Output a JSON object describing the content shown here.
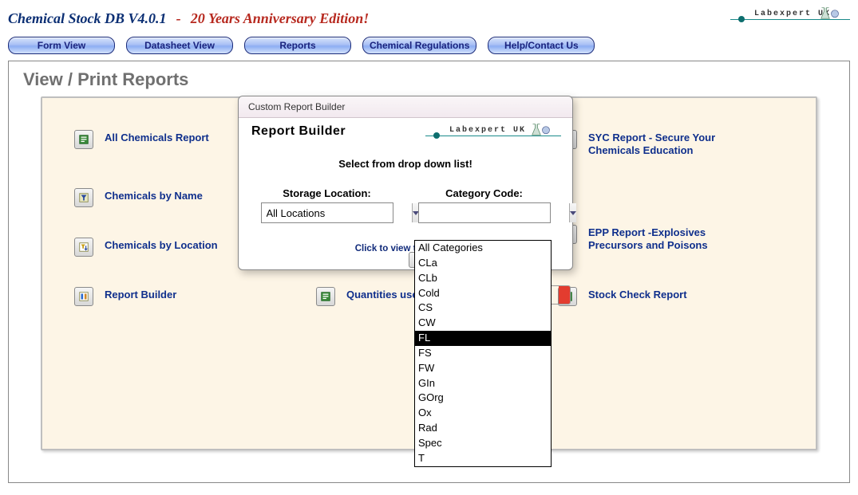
{
  "app": {
    "title": "Chemical Stock DB V4.0.1",
    "sep": "-",
    "subtitle": "20 Years Anniversary Edition!",
    "logo_text": "Labexpert UK"
  },
  "menu": {
    "form_view": "Form View",
    "datasheet_view": "Datasheet View",
    "reports": "Reports",
    "chem_reg": "Chemical Regulations",
    "help": "Help/Contact Us"
  },
  "page": {
    "heading": "View / Print Reports"
  },
  "reports": {
    "all_chem": "All Chemicals Report",
    "by_name": "Chemicals by Name",
    "by_location": "Chemicals by Location",
    "builder": "Report Builder",
    "qty_used": "Quantities used",
    "syc": "SYC Report - Secure Your Chemicals Education",
    "epp": "EPP Report -Explosives Precursors and Poisons",
    "stock_check": "Stock Check Report"
  },
  "dialog": {
    "title": "Custom Report Builder",
    "heading": "Report  Builder",
    "instruction": "Select from drop down list!",
    "storage_label": "Storage Location:",
    "storage_value": "All Locations",
    "category_label": "Category Code:",
    "category_value": "",
    "view_link": "Click to view the report"
  },
  "category_options": [
    "All Categories",
    "CLa",
    "CLb",
    "Cold",
    "CS",
    "CW",
    "FL",
    "FS",
    "FW",
    "GIn",
    "GOrg",
    "Ox",
    "Rad",
    "Spec",
    "T"
  ],
  "category_selected_index": 6
}
